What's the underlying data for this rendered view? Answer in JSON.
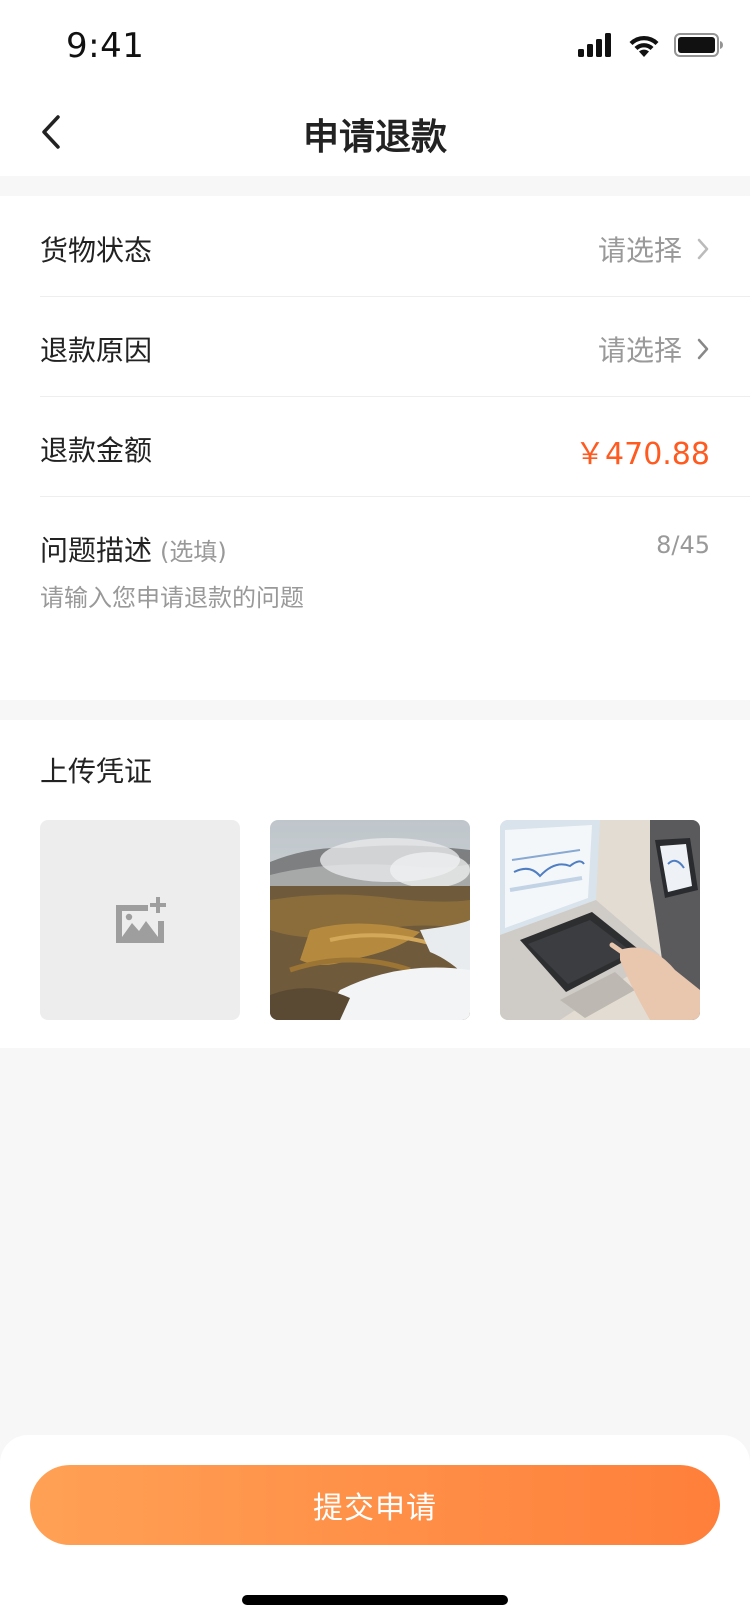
{
  "status_bar": {
    "time": "9:41"
  },
  "nav": {
    "title": "申请退款"
  },
  "form": {
    "goods_status": {
      "label": "货物状态",
      "value": "请选择"
    },
    "refund_reason": {
      "label": "退款原因",
      "value": "请选择"
    },
    "refund_amount": {
      "label": "退款金额",
      "value": "￥470.88"
    },
    "description": {
      "label": "问题描述",
      "optional_text": "(选填)",
      "count": "8/45",
      "placeholder": "请输入您申请退款的问题"
    }
  },
  "upload": {
    "title": "上传凭证"
  },
  "submit": {
    "label": "提交申请"
  },
  "colors": {
    "accent": "#FF5A1F",
    "button_gradient_start": "#FFA155",
    "button_gradient_end": "#FF7F3A"
  }
}
